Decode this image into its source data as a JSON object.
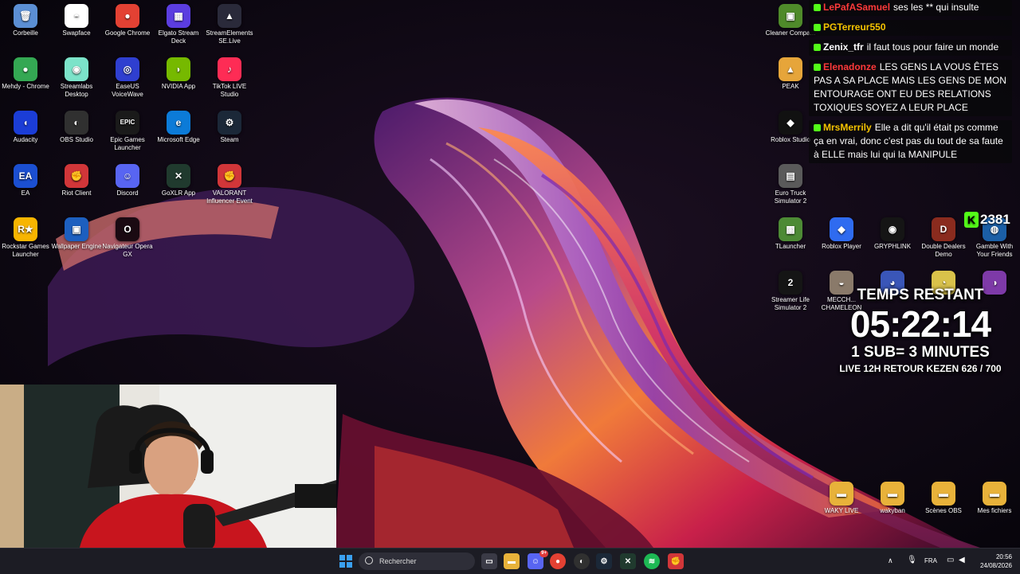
{
  "desktop": {
    "left_icons": [
      {
        "label": "Corbeille",
        "color": "#5b8fd4",
        "glyph": "🗑"
      },
      {
        "label": "Swapface",
        "color": "#ffffff",
        "glyph": "◓"
      },
      {
        "label": "Google Chrome",
        "color": "#e34133",
        "glyph": "●"
      },
      {
        "label": "Elgato Stream Deck",
        "color": "#5b3de0",
        "glyph": "▦"
      },
      {
        "label": "StreamElements SE.Live",
        "color": "#2a2a3a",
        "glyph": "▲"
      },
      {
        "label": "Mehdy - Chrome",
        "color": "#34a853",
        "glyph": "●"
      },
      {
        "label": "Streamlabs Desktop",
        "color": "#7ce3c9",
        "glyph": "◉"
      },
      {
        "label": "EaseUS VoiceWave",
        "color": "#2f3fd0",
        "glyph": "◎"
      },
      {
        "label": "NVIDIA App",
        "color": "#76b900",
        "glyph": "◗"
      },
      {
        "label": "TikTok LIVE Studio",
        "color": "#fe2c55",
        "glyph": "♪"
      },
      {
        "label": "Audacity",
        "color": "#1b3dd6",
        "glyph": "◖"
      },
      {
        "label": "OBS Studio",
        "color": "#303030",
        "glyph": "◐"
      },
      {
        "label": "Epic Games Launcher",
        "color": "#1a1a1a",
        "glyph": "EPIC"
      },
      {
        "label": "Microsoft Edge",
        "color": "#0c7bd8",
        "glyph": "e"
      },
      {
        "label": "Steam",
        "color": "#1b2838",
        "glyph": "⚙"
      },
      {
        "label": "EA",
        "color": "#1b4fd1",
        "glyph": "EA"
      },
      {
        "label": "Riot Client",
        "color": "#d13639",
        "glyph": "✊"
      },
      {
        "label": "Discord",
        "color": "#5865f2",
        "glyph": "☺"
      },
      {
        "label": "GoXLR App",
        "color": "#203a2e",
        "glyph": "✕"
      },
      {
        "label": "VALORANT Influencer Event",
        "color": "#d13639",
        "glyph": "✊"
      },
      {
        "label": "Rockstar Games Launcher",
        "color": "#f7b500",
        "glyph": "R★"
      },
      {
        "label": "Wallpaper Engine",
        "color": "#1d5fbf",
        "glyph": "▣"
      },
      {
        "label": "Navigateur Opera GX",
        "color": "#1a0a12",
        "glyph": "O"
      }
    ],
    "right_icons": [
      {
        "label": "Cleaner Compa...",
        "color": "#4f8a2a",
        "glyph": "▣"
      },
      {
        "label": "PEAK",
        "color": "#e6a53a",
        "glyph": "▲"
      },
      {
        "label": "Roblox Studio",
        "color": "#111111",
        "glyph": "◆"
      },
      {
        "label": "Euro Truck Simulator 2",
        "color": "#5a5a5a",
        "glyph": "▤"
      },
      {
        "label": "TLauncher",
        "color": "#4d8a35",
        "glyph": "▩"
      },
      {
        "label": "Roblox Player",
        "color": "#2f6bf0",
        "glyph": "◆"
      },
      {
        "label": "GRYPHLINK",
        "color": "#151515",
        "glyph": "◉"
      },
      {
        "label": "Double Dealers Demo",
        "color": "#8a2b1e",
        "glyph": "D"
      },
      {
        "label": "Gamble With Your Friends",
        "color": "#1b5fa6",
        "glyph": "◍"
      },
      {
        "label": "Streamer Life Simulator 2",
        "color": "#151515",
        "glyph": "2"
      },
      {
        "label": "MECCH... CHAMELEON",
        "color": "#8a7a6a",
        "glyph": "◒"
      },
      {
        "label": "",
        "color": "#3a56b8",
        "glyph": "◕"
      },
      {
        "label": "",
        "color": "#d9c24a",
        "glyph": "◔"
      },
      {
        "label": "",
        "color": "#7e3aa8",
        "glyph": "◑"
      }
    ],
    "folders": [
      {
        "label": "WAKY LIVE"
      },
      {
        "label": "wakyban"
      },
      {
        "label": "Scènes OBS"
      },
      {
        "label": "Mes fichiers"
      }
    ]
  },
  "chat": [
    {
      "user": "LePafASamuel",
      "user_color": "#ff3a3a",
      "text": "ses les ** qui insulte"
    },
    {
      "user": "PGTerreur550",
      "user_color": "#f5c400",
      "text": ""
    },
    {
      "user": "Zenix_tfr",
      "user_color": "#ffffff",
      "text": "il faut tous pour faire un monde"
    },
    {
      "user": "Elenadonze",
      "user_color": "#ff3a3a",
      "text": "LES GENS LA VOUS ÊTES PAS A SA PLACE MAIS LES GENS DE MON ENTOURAGE ONT EU DES RELATIONS TOXIQUES SOYEZ A LEUR PLACE"
    },
    {
      "user": "MrsMerrily",
      "user_color": "#f5c400",
      "text": "Elle a dit qu'il était ps comme ça en vrai, donc c'est pas du tout de sa faute à ELLE mais lui qui la MANIPULE"
    }
  ],
  "overlay": {
    "sub_icon": "K",
    "sub_count": "2381",
    "timer_title": "TEMPS RESTANT",
    "timer_value": "05:22:14",
    "sub_rule": "1 SUB= 3 MINUTES",
    "goal_text": "LIVE 12H RETOUR KEZEN 626 / 700"
  },
  "taskbar": {
    "search_placeholder": "Rechercher",
    "language": "FRA",
    "time": "20:56",
    "date": "24/08/2026",
    "discord_badge": "9+"
  }
}
